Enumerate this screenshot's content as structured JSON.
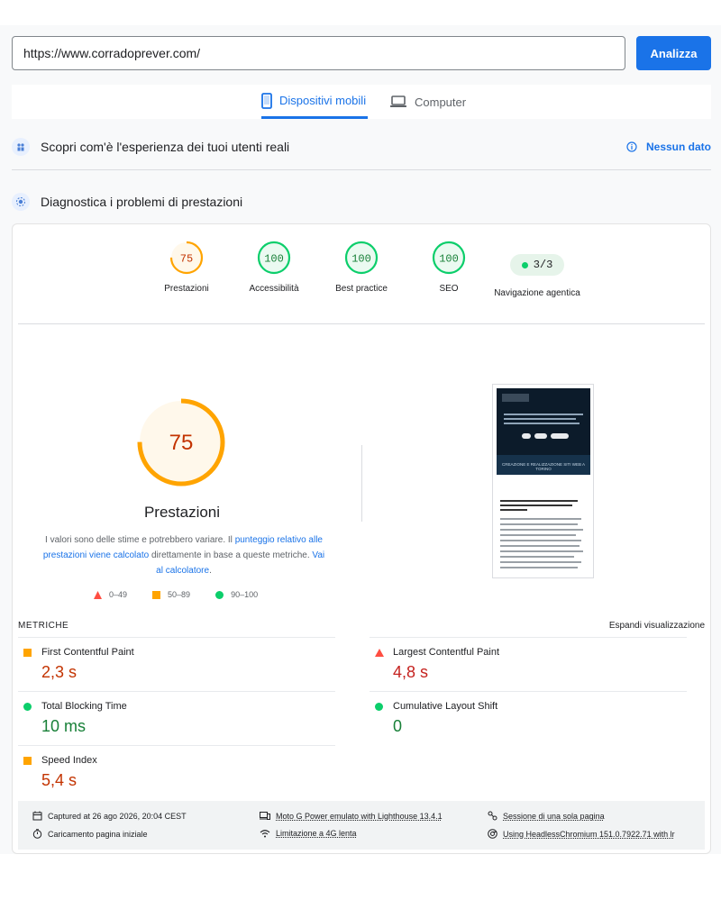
{
  "search": {
    "url": "https://www.corradoprever.com/",
    "analyze_label": "Analizza"
  },
  "tabs": [
    {
      "label": "Dispositivi mobili",
      "icon": "smartphone-icon",
      "active": true
    },
    {
      "label": "Computer",
      "icon": "laptop-icon",
      "active": false
    }
  ],
  "crux": {
    "title": "Scopri com'è l'esperienza dei tuoi utenti reali",
    "no_data_label": "Nessun dato"
  },
  "diagnostics": {
    "title": "Diagnostica i problemi di prestazioni"
  },
  "categories": [
    {
      "label": "Prestazioni",
      "score": "75",
      "level": "average",
      "color": "#ffa400"
    },
    {
      "label": "Accessibilità",
      "score": "100",
      "level": "pass",
      "color": "#0cce6b"
    },
    {
      "label": "Best practice",
      "score": "100",
      "level": "pass",
      "color": "#0cce6b"
    },
    {
      "label": "SEO",
      "score": "100",
      "level": "pass",
      "color": "#0cce6b"
    },
    {
      "label": "Navigazione agentica",
      "score": "3/3",
      "level": "pass",
      "color": "#0cce6b"
    }
  ],
  "performance": {
    "score": "75",
    "score_fraction": 0.75,
    "title": "Prestazioni",
    "desc_part1": "I valori sono delle stime e potrebbero variare. Il ",
    "desc_link1": "punteggio relativo alle prestazioni viene calcolato",
    "desc_part2": " direttamente in base a queste metriche. ",
    "desc_link2": "Vai al calcolatore",
    "desc_part3": ".",
    "legend": [
      {
        "range": "0–49",
        "shape": "triangle",
        "color": "#ff4e42"
      },
      {
        "range": "50–89",
        "shape": "square",
        "color": "#ffa400"
      },
      {
        "range": "90–100",
        "shape": "circle",
        "color": "#0cce6b"
      }
    ]
  },
  "thumbnail": {
    "hero_caption": "CREAZIONE E REALIZZAZIONE SITI WEB A TORINO"
  },
  "metrics": {
    "title": "METRICHE",
    "expand_label": "Espandi visualizzazione",
    "items": [
      {
        "name": "First Contentful Paint",
        "value": "2,3 s",
        "rating": "average",
        "color": "#ffa400"
      },
      {
        "name": "Largest Contentful Paint",
        "value": "4,8 s",
        "rating": "fail",
        "color": "#ff4e42"
      },
      {
        "name": "Total Blocking Time",
        "value": "10 ms",
        "rating": "pass",
        "color": "#0cce6b"
      },
      {
        "name": "Cumulative Layout Shift",
        "value": "0",
        "rating": "pass",
        "color": "#0cce6b"
      },
      {
        "name": "Speed Index",
        "value": "5,4 s",
        "rating": "average",
        "color": "#ffa400"
      }
    ]
  },
  "environment": {
    "captured": "Captured at 26 ago 2026, 20:04 CEST",
    "device": "Moto G Power emulato with Lighthouse 13.4.1",
    "session": "Sessione di una sola pagina",
    "load": "Caricamento pagina iniziale",
    "throttling": "Limitazione a 4G lenta",
    "browser": "Using HeadlessChromium 151.0.7922.71 with lr"
  }
}
